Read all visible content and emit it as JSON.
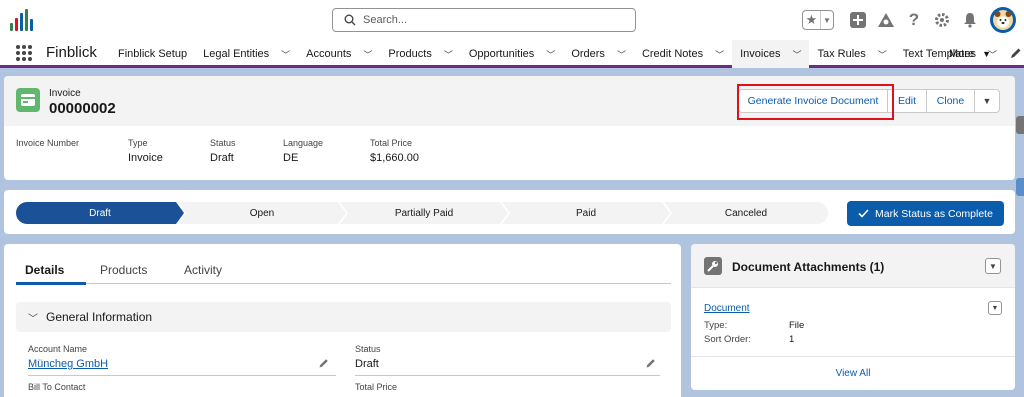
{
  "global_header": {
    "search_placeholder": "Search..."
  },
  "nav": {
    "app_name": "Finblick",
    "items": [
      {
        "label": "Finblick Setup",
        "has_menu": false
      },
      {
        "label": "Legal Entities",
        "has_menu": true
      },
      {
        "label": "Accounts",
        "has_menu": true
      },
      {
        "label": "Products",
        "has_menu": true
      },
      {
        "label": "Opportunities",
        "has_menu": true
      },
      {
        "label": "Orders",
        "has_menu": true
      },
      {
        "label": "Credit Notes",
        "has_menu": true
      },
      {
        "label": "Invoices",
        "has_menu": true,
        "active": true
      },
      {
        "label": "Tax Rules",
        "has_menu": true
      },
      {
        "label": "Text Templates",
        "has_menu": true
      }
    ],
    "more_label": "More"
  },
  "record": {
    "object_label": "Invoice",
    "title": "00000002",
    "actions": {
      "generate": "Generate Invoice Document",
      "edit": "Edit",
      "clone": "Clone"
    },
    "highlights": [
      {
        "label": "Invoice Number",
        "value": ""
      },
      {
        "label": "Type",
        "value": "Invoice"
      },
      {
        "label": "Status",
        "value": "Draft"
      },
      {
        "label": "Language",
        "value": "DE"
      },
      {
        "label": "Total Price",
        "value": "$1,660.00"
      }
    ]
  },
  "path": {
    "steps": [
      "Draft",
      "Open",
      "Partially Paid",
      "Paid",
      "Canceled"
    ],
    "current_index": 0,
    "mark_button": "Mark Status as Complete"
  },
  "details": {
    "tabs": [
      "Details",
      "Products",
      "Activity"
    ],
    "active_tab": 0,
    "section_title": "General Information",
    "fields": {
      "account_name_label": "Account Name",
      "account_name_value": "Müncheg GmbH",
      "status_label": "Status",
      "status_value": "Draft",
      "bill_to_label": "Bill To Contact",
      "total_price_label": "Total Price"
    }
  },
  "attachments": {
    "title": "Document Attachments (1)",
    "item_name": "Document",
    "type_label": "Type:",
    "type_value": "File",
    "sort_label": "Sort Order:",
    "sort_value": "1",
    "view_all": "View All"
  },
  "colors": {
    "brand_blue": "#0b5cab",
    "nav_accent": "#6b2d83",
    "record_icon": "#62b76e",
    "highlight_red": "#e1111b",
    "page_bg": "#b0c4df"
  }
}
